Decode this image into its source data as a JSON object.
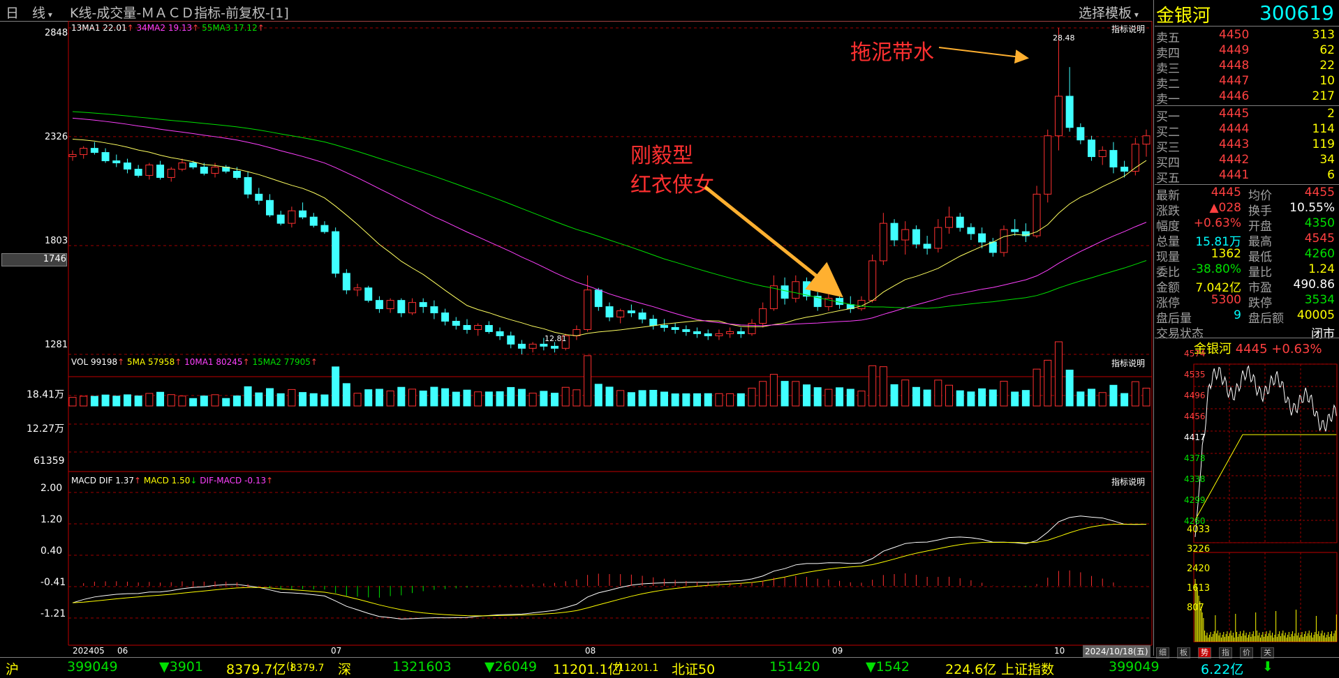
{
  "window": {
    "period_label": "日　线",
    "title": "K线-成交量-ＭＡＣＤ指标-前复权-[1]",
    "template_button": "选择模板",
    "stock_name": "金银河",
    "stock_code": "300619"
  },
  "kline": {
    "legend_ma1": "13MA1 22.01",
    "legend_ma2": "34MA2 19.13",
    "legend_ma3": "55MA3 17.12",
    "indicator_link": "指标说明",
    "y_ticks": [
      "2848",
      "2326",
      "1803",
      "1281"
    ],
    "cursor_price": "1746",
    "high_label": "28.48",
    "low_label": "12.81",
    "annotation1": "拖泥带水",
    "annotation2_line1": "刚毅型",
    "annotation2_line2": "红衣侠女"
  },
  "volume": {
    "legend_vol": "VOL 99198",
    "legend_ma5": "5MA 57958",
    "legend_ma10": "10MA1 80245",
    "legend_ma15": "15MA2 77905",
    "indicator_link": "指标说明",
    "y_ticks": [
      "18.41万",
      "12.27万",
      "61359"
    ]
  },
  "macd": {
    "legend_dif": "MACD DIF 1.37",
    "legend_macd": "MACD 1.50",
    "legend_diff": "DIF-MACD -0.13",
    "indicator_link": "指标说明",
    "y_ticks": [
      "2.00",
      "1.20",
      "0.40",
      "-0.41",
      "-1.21"
    ]
  },
  "x_axis": {
    "labels": [
      "202405",
      "06",
      "07",
      "08",
      "09",
      "10"
    ],
    "current_date": "2024/10/18(五)"
  },
  "quote": {
    "asks": [
      {
        "label": "卖五",
        "price": "4450",
        "vol": "313"
      },
      {
        "label": "卖四",
        "price": "4449",
        "vol": "62"
      },
      {
        "label": "卖三",
        "price": "4448",
        "vol": "22"
      },
      {
        "label": "卖二",
        "price": "4447",
        "vol": "10"
      },
      {
        "label": "卖一",
        "price": "4446",
        "vol": "217"
      }
    ],
    "bids": [
      {
        "label": "买一",
        "price": "4445",
        "vol": "2"
      },
      {
        "label": "买二",
        "price": "4444",
        "vol": "114"
      },
      {
        "label": "买三",
        "price": "4443",
        "vol": "119"
      },
      {
        "label": "买四",
        "price": "4442",
        "vol": "34"
      },
      {
        "label": "买五",
        "price": "4441",
        "vol": "6"
      }
    ],
    "stats": [
      {
        "l1": "最新",
        "v1": "4445",
        "c1": "red",
        "l2": "均价",
        "v2": "4455",
        "c2": "red"
      },
      {
        "l1": "涨跌",
        "v1": "▲028",
        "c1": "red",
        "l2": "换手",
        "v2": "10.55%",
        "c2": "wht"
      },
      {
        "l1": "幅度",
        "v1": "+0.63%",
        "c1": "red",
        "l2": "开盘",
        "v2": "4350",
        "c2": "grn"
      },
      {
        "l1": "总量",
        "v1": "15.81万",
        "c1": "cyan",
        "l2": "最高",
        "v2": "4545",
        "c2": "red"
      },
      {
        "l1": "现量",
        "v1": "1362",
        "c1": "yel",
        "l2": "最低",
        "v2": "4260",
        "c2": "grn"
      },
      {
        "l1": "委比",
        "v1": "-38.80%",
        "c1": "grn",
        "l2": "量比",
        "v2": "1.24",
        "c2": "yel"
      },
      {
        "l1": "金额",
        "v1": "7.042亿",
        "c1": "yel",
        "l2": "市盈",
        "v2": "490.86",
        "c2": "wht"
      },
      {
        "l1": "涨停",
        "v1": "5300",
        "c1": "red",
        "l2": "跌停",
        "v2": "3534",
        "c2": "grn"
      },
      {
        "l1": "盘后量",
        "v1": "9",
        "c1": "cyan",
        "l2": "盘后额",
        "v2": "40005",
        "c2": "yel"
      }
    ],
    "trade_state_label": "交易状态",
    "trade_state_value": "闭市"
  },
  "mini": {
    "header_name": "金银河",
    "header_price": "4445",
    "header_change": "+0.63%",
    "price_ticks": [
      "4574",
      "4535",
      "4496",
      "4456",
      "4417",
      "4378",
      "4338",
      "4299",
      "4260"
    ],
    "vol_ticks": [
      "4033",
      "3226",
      "2420",
      "1613",
      "807"
    ],
    "tabs": [
      "细",
      "板",
      "势",
      "指",
      "价",
      "关"
    ]
  },
  "bottombar": {
    "sh_label": "沪",
    "sh_index": "399049",
    "sh_change": "▼3901",
    "sh_amount": "8379.7亿",
    "sh_amount2": "8379.7",
    "sz_label": "深",
    "sz_index": "1321603",
    "sz_change": "▼26049",
    "sz_amount": "11201.1亿",
    "sz_amount2": "11201.1",
    "bz_label": "北证50",
    "bz_index": "151420",
    "bz_change": "▼1542",
    "bz_amount": "224.6亿",
    "idx_label": "上证指数",
    "idx_value": "399049",
    "idx_amount": "6.22亿",
    "idx_arrow": "⬇"
  },
  "chart_data": {
    "type": "candlestick",
    "title": "K线-成交量-ＭＡＣＤ指标-前复权-[1]",
    "ylim": [
      12.81,
      28.48
    ],
    "x_labels": [
      "202405",
      "06",
      "07",
      "08",
      "09",
      "10"
    ],
    "candles": [
      [
        22.3,
        22.6,
        22.1,
        22.4
      ],
      [
        22.4,
        22.8,
        22.2,
        22.7
      ],
      [
        22.7,
        23.0,
        22.4,
        22.5
      ],
      [
        22.5,
        22.7,
        22.0,
        22.1
      ],
      [
        22.1,
        22.4,
        21.8,
        22.0
      ],
      [
        22.0,
        22.2,
        21.5,
        21.7
      ],
      [
        21.7,
        21.9,
        21.3,
        21.4
      ],
      [
        21.4,
        22.0,
        21.2,
        21.9
      ],
      [
        21.9,
        22.1,
        21.2,
        21.3
      ],
      [
        21.3,
        21.8,
        21.1,
        21.7
      ],
      [
        21.7,
        22.2,
        21.6,
        22.0
      ],
      [
        22.0,
        22.1,
        21.7,
        21.8
      ],
      [
        21.8,
        22.0,
        21.4,
        21.5
      ],
      [
        21.5,
        22.0,
        21.3,
        21.8
      ],
      [
        21.8,
        21.9,
        21.5,
        21.6
      ],
      [
        21.6,
        21.8,
        21.2,
        21.3
      ],
      [
        21.3,
        21.6,
        20.3,
        20.5
      ],
      [
        20.5,
        20.8,
        20.0,
        20.2
      ],
      [
        20.2,
        20.5,
        19.4,
        19.5
      ],
      [
        19.5,
        19.7,
        19.0,
        19.1
      ],
      [
        19.1,
        19.9,
        18.9,
        19.7
      ],
      [
        19.7,
        20.1,
        19.3,
        19.4
      ],
      [
        19.4,
        19.6,
        18.9,
        19.0
      ],
      [
        19.0,
        19.2,
        18.6,
        18.7
      ],
      [
        18.7,
        18.9,
        16.5,
        16.7
      ],
      [
        16.7,
        16.9,
        15.7,
        15.9
      ],
      [
        15.9,
        16.2,
        15.6,
        16.0
      ],
      [
        16.0,
        16.1,
        15.3,
        15.4
      ],
      [
        15.4,
        15.6,
        14.8,
        15.0
      ],
      [
        15.0,
        15.5,
        14.8,
        15.4
      ],
      [
        15.4,
        15.5,
        14.6,
        14.8
      ],
      [
        14.8,
        15.5,
        14.7,
        15.3
      ],
      [
        15.3,
        15.5,
        14.8,
        15.1
      ],
      [
        15.1,
        15.4,
        14.5,
        14.8
      ],
      [
        14.8,
        15.0,
        14.2,
        14.4
      ],
      [
        14.4,
        14.6,
        14.0,
        14.2
      ],
      [
        14.2,
        14.5,
        13.8,
        14.0
      ],
      [
        14.0,
        14.3,
        13.7,
        14.2
      ],
      [
        14.2,
        14.4,
        13.8,
        13.9
      ],
      [
        13.9,
        14.1,
        13.5,
        13.7
      ],
      [
        13.7,
        13.9,
        13.1,
        13.3
      ],
      [
        13.3,
        13.5,
        12.81,
        13.1
      ],
      [
        13.1,
        13.4,
        12.9,
        13.3
      ],
      [
        13.3,
        13.6,
        13.0,
        13.2
      ],
      [
        13.2,
        13.4,
        12.9,
        13.1
      ],
      [
        13.1,
        13.8,
        13.0,
        13.7
      ],
      [
        13.7,
        14.2,
        13.5,
        14.0
      ],
      [
        14.0,
        16.6,
        13.9,
        15.9
      ],
      [
        15.9,
        16.0,
        14.9,
        15.1
      ],
      [
        15.1,
        15.3,
        14.4,
        14.6
      ],
      [
        14.6,
        15.0,
        14.3,
        14.9
      ],
      [
        14.9,
        15.2,
        14.6,
        14.8
      ],
      [
        14.8,
        15.0,
        14.3,
        14.5
      ],
      [
        14.5,
        14.7,
        14.0,
        14.2
      ],
      [
        14.2,
        14.5,
        13.9,
        14.1
      ],
      [
        14.1,
        14.3,
        13.8,
        14.0
      ],
      [
        14.0,
        14.2,
        13.7,
        13.9
      ],
      [
        13.9,
        14.1,
        13.6,
        13.8
      ],
      [
        13.8,
        14.0,
        13.5,
        13.7
      ],
      [
        13.7,
        14.0,
        13.5,
        13.8
      ],
      [
        13.8,
        14.1,
        13.6,
        13.9
      ],
      [
        13.9,
        14.1,
        13.6,
        13.8
      ],
      [
        13.8,
        14.5,
        13.7,
        14.3
      ],
      [
        14.3,
        15.3,
        14.1,
        15.0
      ],
      [
        15.0,
        16.6,
        14.9,
        16.1
      ],
      [
        16.1,
        16.5,
        15.2,
        15.5
      ],
      [
        15.5,
        16.6,
        15.3,
        16.3
      ],
      [
        16.3,
        16.5,
        15.4,
        15.6
      ],
      [
        15.6,
        15.8,
        14.9,
        15.1
      ],
      [
        15.1,
        15.7,
        14.9,
        15.5
      ],
      [
        15.5,
        15.9,
        15.0,
        15.2
      ],
      [
        15.2,
        15.6,
        14.8,
        15.0
      ],
      [
        15.0,
        15.6,
        14.9,
        15.4
      ],
      [
        15.4,
        17.6,
        15.3,
        17.3
      ],
      [
        17.3,
        19.6,
        17.1,
        19.1
      ],
      [
        19.1,
        19.3,
        18.0,
        18.3
      ],
      [
        18.3,
        19.2,
        17.6,
        18.8
      ],
      [
        18.8,
        19.0,
        17.9,
        18.1
      ],
      [
        18.1,
        18.5,
        17.6,
        17.9
      ],
      [
        17.9,
        19.3,
        17.7,
        18.9
      ],
      [
        18.9,
        19.9,
        18.6,
        19.4
      ],
      [
        19.4,
        19.6,
        18.7,
        18.9
      ],
      [
        18.9,
        19.1,
        18.3,
        18.6
      ],
      [
        18.6,
        18.9,
        17.9,
        18.2
      ],
      [
        18.2,
        18.4,
        17.5,
        17.7
      ],
      [
        17.7,
        19.0,
        17.5,
        18.8
      ],
      [
        18.8,
        19.3,
        18.5,
        18.7
      ],
      [
        18.7,
        19.1,
        18.2,
        18.5
      ],
      [
        18.5,
        20.9,
        18.4,
        20.5
      ],
      [
        20.5,
        23.6,
        20.1,
        23.3
      ],
      [
        23.3,
        28.48,
        22.6,
        25.2
      ],
      [
        25.2,
        26.6,
        23.5,
        23.7
      ],
      [
        23.7,
        23.9,
        22.9,
        23.1
      ],
      [
        23.1,
        23.3,
        22.1,
        22.3
      ],
      [
        22.3,
        22.8,
        21.9,
        22.6
      ],
      [
        22.6,
        23.0,
        21.5,
        21.8
      ],
      [
        21.8,
        22.1,
        21.3,
        21.6
      ],
      [
        21.6,
        23.2,
        21.4,
        22.9
      ],
      [
        22.9,
        23.6,
        22.3,
        23.3
      ]
    ],
    "vol_ylim": [
      0,
      184100
    ],
    "macd_ylim": [
      -2.0,
      2.4
    ]
  }
}
